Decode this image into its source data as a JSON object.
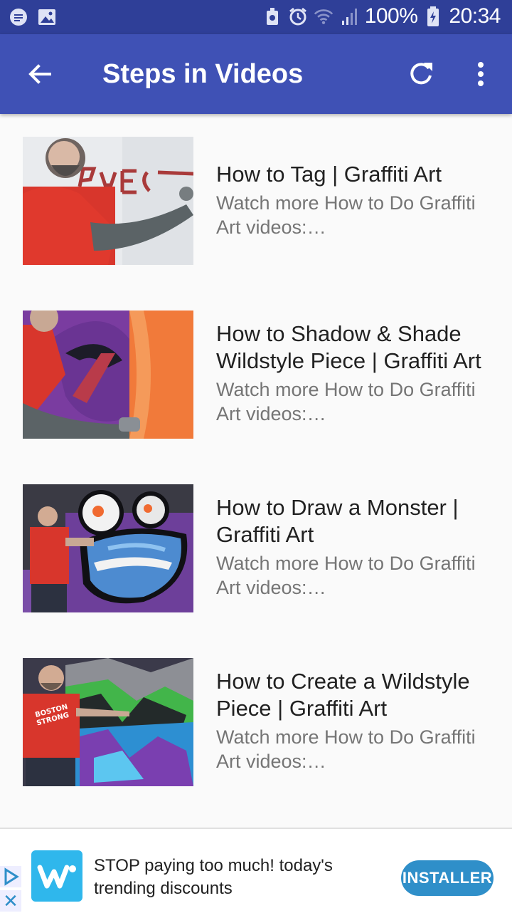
{
  "status_bar": {
    "battery": "100%",
    "time": "20:34"
  },
  "app_bar": {
    "title": "Steps in Videos"
  },
  "videos": [
    {
      "title": "How to Tag | Graffiti Art",
      "description": "Watch more How to Do Graffiti Art videos: http://www.howcast.com"
    },
    {
      "title": "How to Shadow & Shade Wildstyle Piece | Graffiti Art",
      "description": "Watch more How to Do Graffiti Art videos: http://www.howcast.com"
    },
    {
      "title": "How to Draw a Monster | Graffiti Art",
      "description": "Watch more How to Do Graffiti Art videos: http://www.howcast.com"
    },
    {
      "title": "How to Create a Wildstyle Piece | Graffiti Art",
      "description": "Watch more How to Do Graffiti Art videos: http://www.howcast.com"
    }
  ],
  "ad": {
    "text": "STOP paying too much! today's trending discounts",
    "cta": "INSTALLER",
    "logo_letter": "w"
  },
  "colors": {
    "status_bar": "#2f3f98",
    "app_bar": "#3f51b5",
    "ad_button": "#2f8fc9"
  }
}
